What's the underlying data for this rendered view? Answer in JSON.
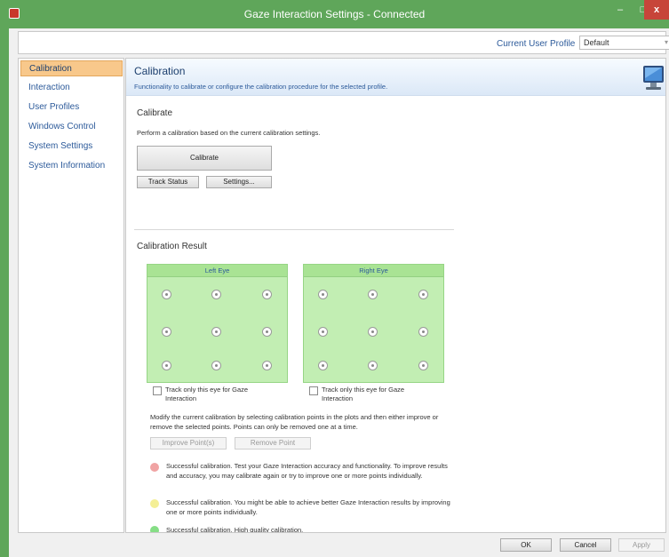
{
  "window": {
    "title": "Gaze Interaction Settings - Connected",
    "minimize": "‒",
    "maximize": "□",
    "close": "x"
  },
  "profile": {
    "label": "Current User Profile",
    "selected": "Default"
  },
  "sidebar": {
    "items": [
      {
        "label": "Calibration",
        "active": true
      },
      {
        "label": "Interaction",
        "active": false
      },
      {
        "label": "User Profiles",
        "active": false
      },
      {
        "label": "Windows Control",
        "active": false
      },
      {
        "label": "System Settings",
        "active": false
      },
      {
        "label": "System Information",
        "active": false
      }
    ]
  },
  "header": {
    "title": "Calibration",
    "description": "Functionality to calibrate or configure the calibration procedure for the selected profile."
  },
  "calibrate": {
    "title": "Calibrate",
    "description": "Perform a calibration based on the current calibration settings.",
    "calibrate_button": "Calibrate",
    "track_status_button": "Track Status",
    "settings_button": "Settings..."
  },
  "result": {
    "title": "Calibration Result",
    "left_eye": "Left Eye",
    "right_eye": "Right Eye",
    "left_checkbox": "Track only this eye for Gaze Interaction",
    "right_checkbox": "Track only this eye for Gaze Interaction",
    "instructions": "Modify the current calibration by selecting calibration points in the plots and then either improve or remove the selected points. Points can only be removed one at a time.",
    "improve_button": "Improve Point(s)",
    "remove_button": "Remove Point"
  },
  "legend": [
    {
      "color": "#f0a3a3",
      "text": "Successful calibration. Test your Gaze Interaction accuracy and functionality. To improve results and accuracy, you may calibrate again or try to improve one or more points individually."
    },
    {
      "color": "#f4ef96",
      "text": "Successful calibration. You might be able to achieve better Gaze Interaction results by improving one or more points individually."
    },
    {
      "color": "#86de86",
      "text": "Successful calibration. High quality calibration."
    }
  ],
  "footer": {
    "ok": "OK",
    "cancel": "Cancel",
    "apply": "Apply"
  }
}
